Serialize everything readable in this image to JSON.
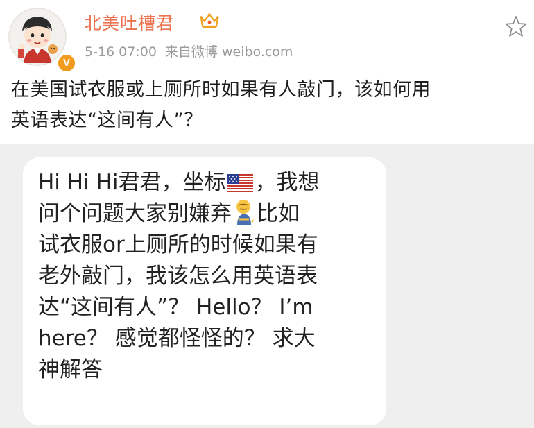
{
  "header": {
    "username": "北美吐槽君",
    "crown_icon": "crown-vip-icon",
    "verified_badge": "V",
    "timestamp": "5-16 07:00",
    "source": "来自微博 weibo.com",
    "favorite_icon": "star-outline-icon"
  },
  "post": {
    "line1": "在美国试衣服或上厕所时如果有人敲门，该如何用",
    "line2": "英语表达“这间有人”？"
  },
  "image": {
    "lines": [
      {
        "a": "Hi Hi Hi君君，坐标",
        "b": "，我想"
      },
      {
        "a": "问个问题大家别嫌弃",
        "b": "比如"
      },
      {
        "a": "试衣服or上厕所的时候如果有",
        "b": ""
      },
      {
        "a": "老外敲门，我该怎么用英语表",
        "b": ""
      },
      {
        "a": "达“这间有人”？ Hello？ I’m",
        "b": ""
      },
      {
        "a": "here？ 感觉都怪怪的？ 求大",
        "b": ""
      },
      {
        "a": "神解答",
        "b": ""
      }
    ],
    "flag_icon": "us-flag-icon",
    "emoji_icon": "bowing-person-emoji"
  },
  "colors": {
    "username": "#eb7350",
    "meta": "#9a9a9a",
    "image_background": "#efefef",
    "badge": "#f29c1f"
  }
}
